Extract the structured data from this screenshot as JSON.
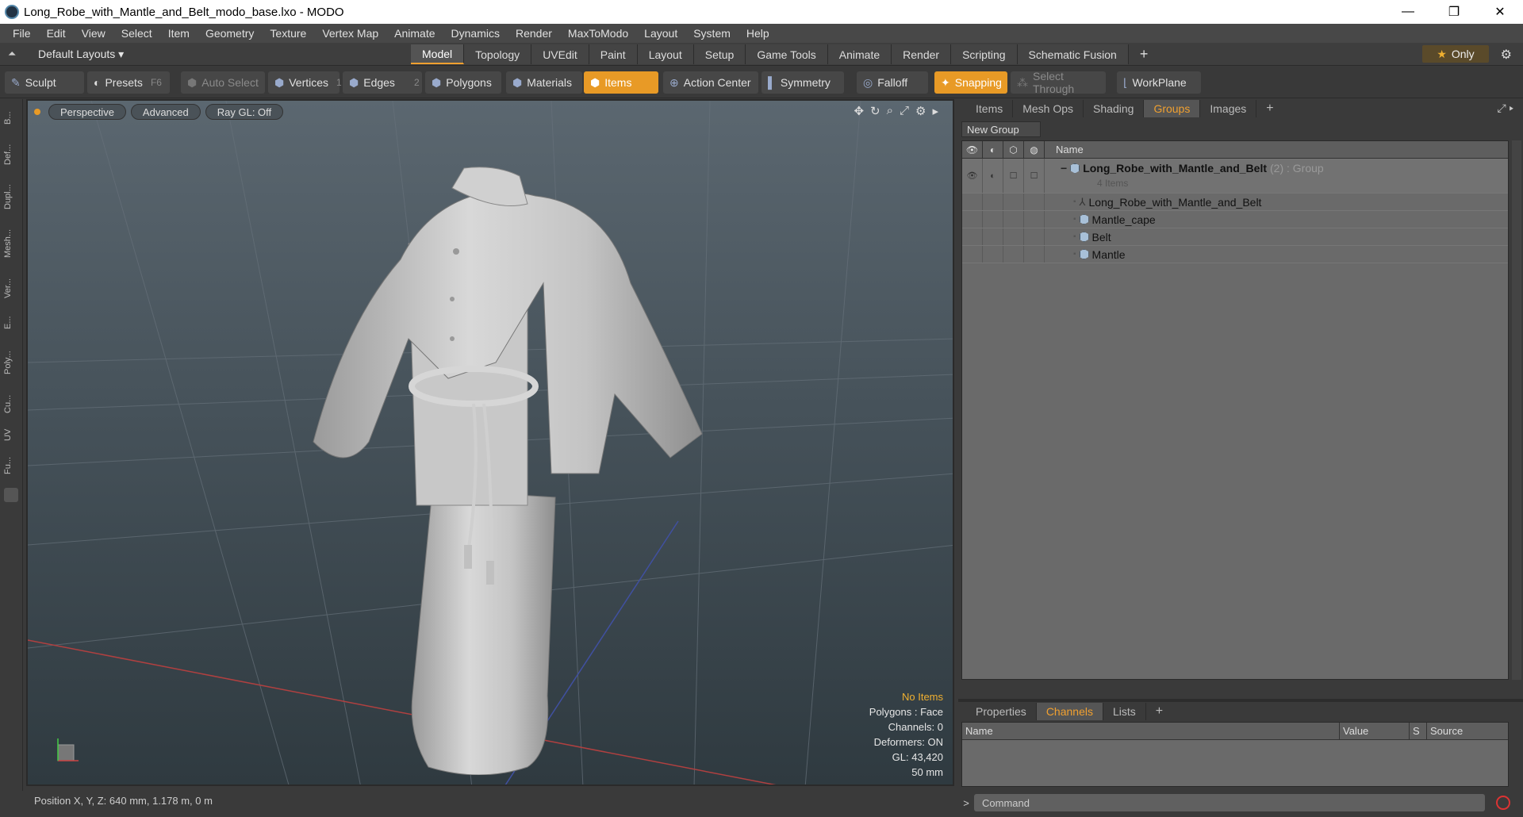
{
  "window": {
    "title": "Long_Robe_with_Mantle_and_Belt_modo_base.lxo - MODO",
    "minimize": "—",
    "restore": "❐",
    "close": "✕"
  },
  "menu": [
    "File",
    "Edit",
    "View",
    "Select",
    "Item",
    "Geometry",
    "Texture",
    "Vertex Map",
    "Animate",
    "Dynamics",
    "Render",
    "MaxToModo",
    "Layout",
    "System",
    "Help"
  ],
  "layoutbar": {
    "default_layouts": "Default Layouts ▾",
    "tabs": [
      "Model",
      "Topology",
      "UVEdit",
      "Paint",
      "Layout",
      "Setup",
      "Game Tools",
      "Animate",
      "Render",
      "Scripting",
      "Schematic Fusion"
    ],
    "active_tab": "Model",
    "plus": "+",
    "only": "Only"
  },
  "toolbar": {
    "sculpt": "Sculpt",
    "presets": "Presets",
    "presets_key": "F6",
    "auto_select": "Auto Select",
    "vertices": "Vertices",
    "vertices_n": "1",
    "edges": "Edges",
    "edges_n": "2",
    "polygons": "Polygons",
    "materials": "Materials",
    "items": "Items",
    "action_center": "Action Center",
    "symmetry": "Symmetry",
    "falloff": "Falloff",
    "snapping": "Snapping",
    "select_through": "Select Through",
    "workplane": "WorkPlane"
  },
  "leftstrip": [
    "B...",
    "Def...",
    "Dupl...",
    "Mesh...",
    "Ver...",
    "E...",
    "Poly...",
    "Cu...",
    "UV",
    "Fu..."
  ],
  "viewport": {
    "perspective": "Perspective",
    "advanced": "Advanced",
    "raygl": "Ray GL: Off",
    "info": {
      "no_items": "No Items",
      "polygons": "Polygons : Face",
      "channels": "Channels: 0",
      "deformers": "Deformers: ON",
      "gl": "GL: 43,420",
      "scale": "50 mm"
    }
  },
  "status": {
    "position": "Position X, Y, Z:  640 mm, 1.178 m, 0 m"
  },
  "right": {
    "tabs": [
      "Items",
      "Mesh Ops",
      "Shading",
      "Groups",
      "Images"
    ],
    "active_tab": "Groups",
    "plus": "+",
    "new_group": "New Group",
    "list_header": "Name",
    "group": {
      "name": "Long_Robe_with_Mantle_and_Belt",
      "suffix": "(2) : Group",
      "count": "4 Items"
    },
    "children": [
      {
        "name": "Long_Robe_with_Mantle_and_Belt",
        "icon": "locator-icon"
      },
      {
        "name": "Mantle_cape",
        "icon": "mesh-icon"
      },
      {
        "name": "Belt",
        "icon": "mesh-icon"
      },
      {
        "name": "Mantle",
        "icon": "mesh-icon"
      }
    ],
    "bottom_tabs": [
      "Properties",
      "Channels",
      "Lists"
    ],
    "bottom_active": "Channels",
    "chan_headers": {
      "name": "Name",
      "value": "Value",
      "s": "S",
      "source": "Source"
    },
    "command_placeholder": "Command",
    "prompt": ">"
  },
  "colors": {
    "accent": "#e89a26"
  }
}
